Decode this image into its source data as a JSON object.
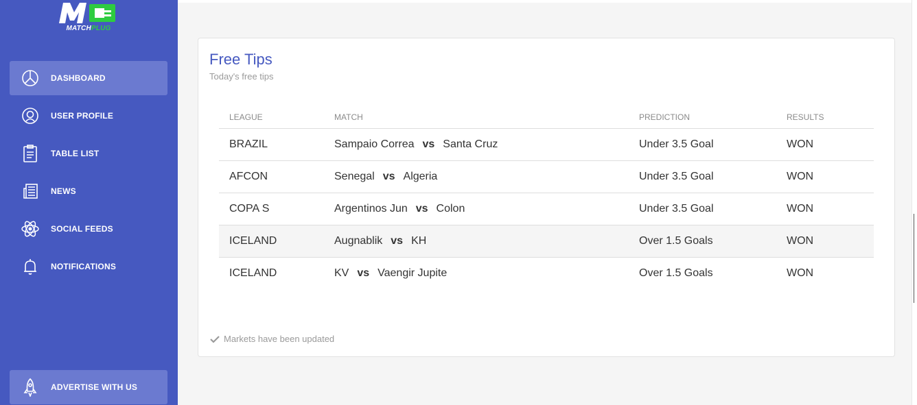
{
  "brand": {
    "logo_letters": "M",
    "name_part1": "MATCH",
    "name_part2": "PLUG",
    "colors": {
      "sidebar": "#4659c0",
      "accent_green": "#2ecc40",
      "title": "#4659c0"
    }
  },
  "sidebar": {
    "items": [
      {
        "label": "DASHBOARD",
        "icon": "pie-chart-icon",
        "active": true
      },
      {
        "label": "USER PROFILE",
        "icon": "user-icon",
        "active": false
      },
      {
        "label": "TABLE LIST",
        "icon": "clipboard-icon",
        "active": false
      },
      {
        "label": "NEWS",
        "icon": "newspaper-icon",
        "active": false
      },
      {
        "label": "SOCIAL FEEDS",
        "icon": "atom-icon",
        "active": false
      },
      {
        "label": "NOTIFICATIONS",
        "icon": "bell-icon",
        "active": false
      }
    ],
    "advertise": {
      "label": "ADVERTISE WITH US",
      "icon": "rocket-icon"
    }
  },
  "card": {
    "title": "Free Tips",
    "subtitle": "Today's free tips",
    "columns": [
      "LEAGUE",
      "MATCH",
      "PREDICTION",
      "RESULTS"
    ],
    "vs_label": "vs",
    "rows": [
      {
        "league": "BRAZIL",
        "home": "Sampaio Correa",
        "away": "Santa Cruz",
        "prediction": "Under 3.5 Goal",
        "result": "WON"
      },
      {
        "league": "AFCON",
        "home": "Senegal",
        "away": "Algeria",
        "prediction": "Under 3.5 Goal",
        "result": "WON"
      },
      {
        "league": "COPA S",
        "home": "Argentinos Jun",
        "away": "Colon",
        "prediction": "Under 3.5 Goal",
        "result": "WON"
      },
      {
        "league": "ICELAND",
        "home": "Augnablik",
        "away": "KH",
        "prediction": "Over 1.5 Goals",
        "result": "WON"
      },
      {
        "league": "ICELAND",
        "home": "KV",
        "away": "Vaengir Jupite",
        "prediction": "Over 1.5 Goals",
        "result": "WON"
      }
    ],
    "footer_note": "Markets have been updated"
  }
}
